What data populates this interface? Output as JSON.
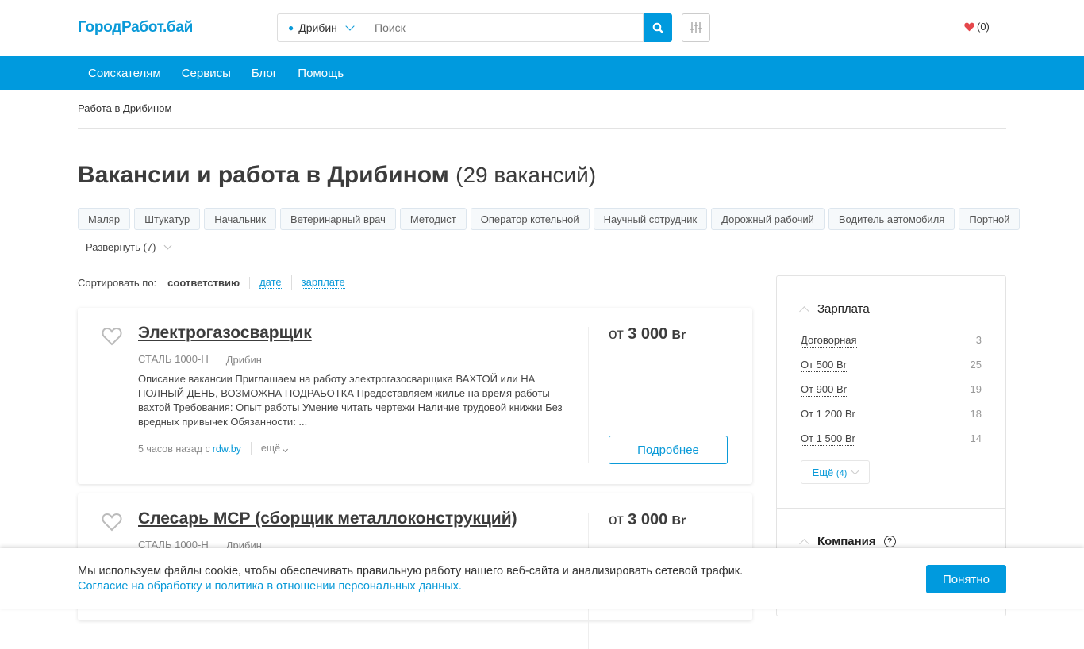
{
  "header": {
    "logo": "ГородРабот.бай",
    "city": "Дрибин",
    "search_placeholder": "Поиск",
    "favorites": "(0)"
  },
  "nav": [
    "Соискателям",
    "Сервисы",
    "Блог",
    "Помощь"
  ],
  "breadcrumb": "Работа в Дрибином",
  "page": {
    "title": "Вакансии и работа в Дрибином",
    "count": "(29 вакансий)"
  },
  "tags": [
    "Маляр",
    "Штукатур",
    "Начальник",
    "Ветеринарный врач",
    "Методист",
    "Оператор котельной",
    "Научный сотрудник",
    "Дорожный рабочий",
    "Водитель автомобиля",
    "Портной"
  ],
  "expand": "Развернуть (7)",
  "sort": {
    "label": "Сортировать по:",
    "current": "соответствию",
    "options": [
      "дате",
      "зарплате"
    ]
  },
  "jobs": [
    {
      "title": "Электрогазосварщик",
      "company": "СТАЛЬ 1000-Н",
      "city": "Дрибин",
      "description": "Описание вакансии Приглашаем на работу электрогазосварщика ВАХТОЙ или НА ПОЛНЫЙ ДЕНЬ, ВОЗМОЖНА ПОДРАБОТКА Предоставляем жилье на время работы вахтой Требования: Опыт работы Умение читать чертежи Наличие трудовой книжки Без вредных привычек Обязанности: ...",
      "time": "5 часов назад с",
      "source": "rdw.by",
      "more": "ещё",
      "price_prefix": "от",
      "price": "3 000",
      "currency": "Br",
      "button": "Подробнее"
    },
    {
      "title": "Слесарь МСР (сборщик металлоконструкций)",
      "company": "СТАЛЬ 1000-Н",
      "city": "Дрибин",
      "price_prefix": "от",
      "price": "3 000",
      "currency": "Br"
    }
  ],
  "sidebar": {
    "salary_title": "Зарплата",
    "salary": [
      {
        "label": "Договорная",
        "count": "3"
      },
      {
        "label": "От 500 Br",
        "count": "25"
      },
      {
        "label": "От 900 Br",
        "count": "19"
      },
      {
        "label": "От 1 200 Br",
        "count": "18"
      },
      {
        "label": "От 1 500 Br",
        "count": "14"
      }
    ],
    "more": "Ещё",
    "more_count": "(4)",
    "company_title": "Компания"
  },
  "cookie": {
    "text": "Мы используем файлы cookie, чтобы обеспечивать правильную работу нашего веб-сайта и анализировать сетевой трафик.",
    "link": "Согласие на обработку и политика в отношении персональных данных.",
    "button": "Понятно"
  },
  "colors": {
    "accent": "#009ADE",
    "heart": "#E5474B"
  }
}
